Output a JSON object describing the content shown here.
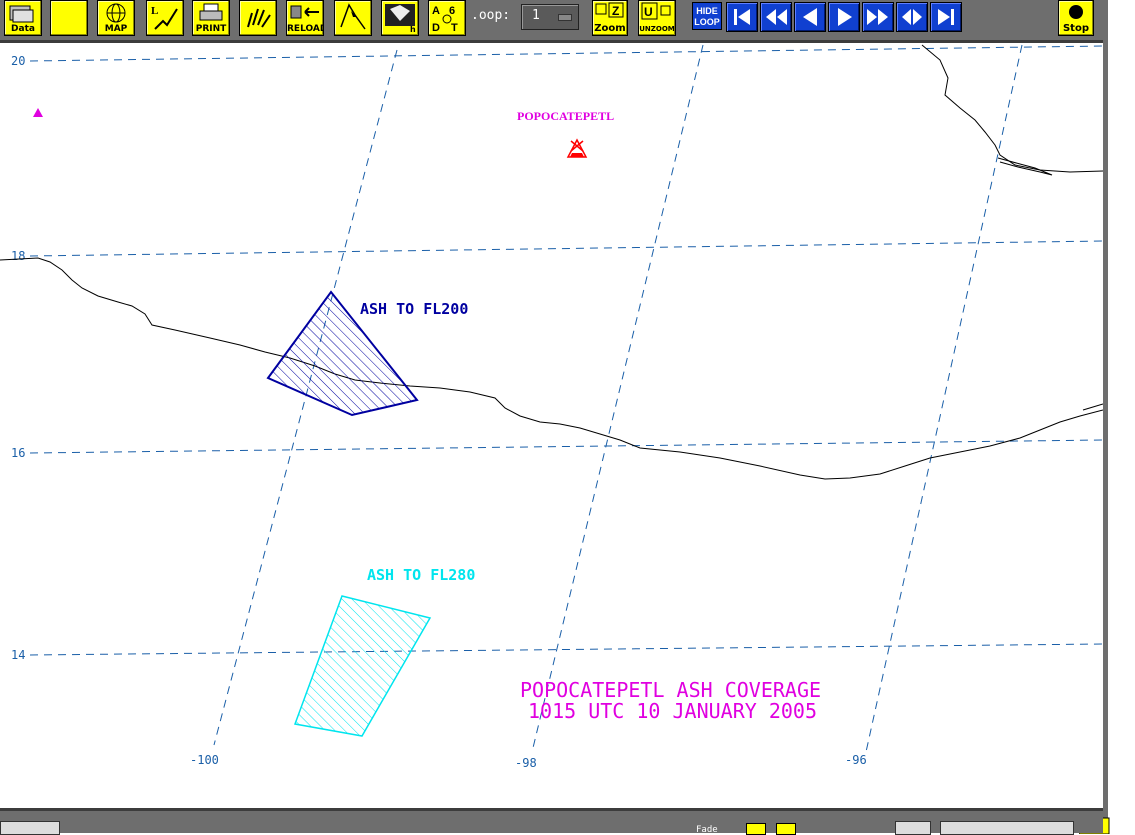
{
  "toolbar": {
    "buttons": [
      {
        "name": "data-button",
        "label": "Data"
      },
      {
        "name": "blank-button",
        "label": ""
      },
      {
        "name": "map-button",
        "label": "MAP"
      },
      {
        "name": "line-draw-button",
        "label": ""
      },
      {
        "name": "print-button",
        "label": "PRINT"
      },
      {
        "name": "pan-hand-button",
        "label": ""
      },
      {
        "name": "reload-button",
        "label": "RELOAD"
      },
      {
        "name": "pointer-button",
        "label": ""
      },
      {
        "name": "flag-button",
        "label": ""
      },
      {
        "name": "annotate-button",
        "label": ""
      }
    ],
    "loop_label": ".oop:",
    "loop_value": "1",
    "zoom_label": "Zoom",
    "unzoom_label": "UNZOOM",
    "hide_loop_label": "HIDE LOOP",
    "stop_label": "Stop",
    "icons": [
      "first-frame-icon",
      "rewind-icon",
      "step-back-icon",
      "play-icon",
      "fast-forward-icon",
      "rock-icon",
      "last-frame-icon"
    ],
    "nav_color": "#1040d0",
    "button_color": "#ffff00"
  },
  "map": {
    "lat_labels": [
      "20",
      "18",
      "16",
      "14"
    ],
    "lon_labels": [
      "-100",
      "-98",
      "-96"
    ],
    "volcano_label": "POPOCATEPETL",
    "ash_fl200_label": "ASH TO FL200",
    "ash_fl280_label": "ASH TO FL280",
    "title_line1": "POPOCATEPETL ASH COVERAGE",
    "title_line2": "1015 UTC 10 JANUARY 2005",
    "colors": {
      "grid": "#1a5fa8",
      "fl200": "#0000a0",
      "fl280": "#00e5ee",
      "title": "#e000e0",
      "coast": "#000000",
      "volcano": "#ff0000"
    }
  },
  "status": {
    "field_text": "Fade"
  }
}
